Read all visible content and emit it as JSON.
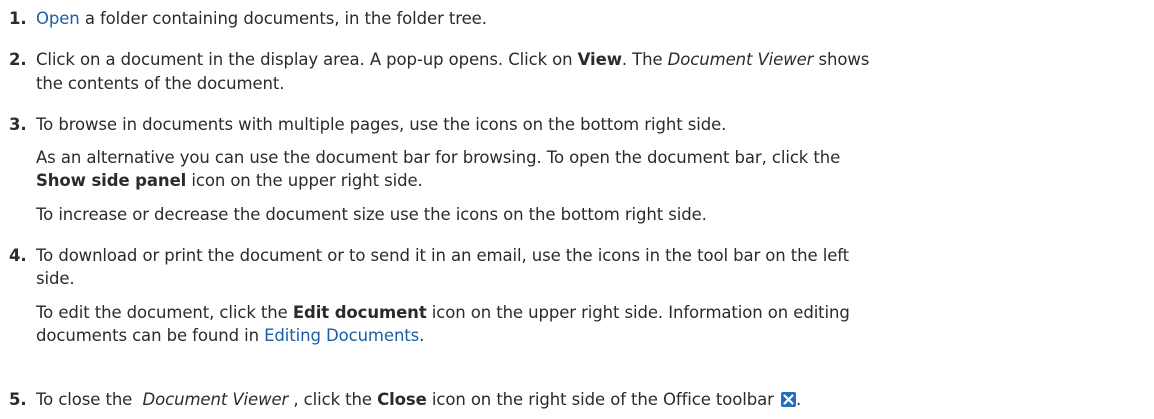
{
  "steps": [
    {
      "num": "1.",
      "lines": [
        {
          "link": "Open",
          "rest": " a folder containing documents, in the folder tree."
        }
      ]
    },
    {
      "num": "2.",
      "lines": [
        {
          "a": "Click on a document in the display area. A pop-up opens. Click on ",
          "b": "View",
          "c": ". The ",
          "i": "Document Viewer",
          "d": " shows"
        },
        {
          "a": "the contents of the document."
        }
      ]
    },
    {
      "num": "3.",
      "lines": [
        {
          "a": "To browse in documents with multiple pages, use the icons on the bottom right side."
        },
        {
          "a": "As an alternative you can use the document bar for browsing. To open the document bar, click the"
        },
        {
          "b": "Show side panel",
          "a": " icon on the upper right side."
        },
        {
          "a": "To increase or decrease the document size use the icons on the bottom right side."
        }
      ]
    },
    {
      "num": "4.",
      "lines": [
        {
          "a": "To download or print the document or to send it in an email, use the icons in the tool bar on the left"
        },
        {
          "a": "side."
        },
        {
          "a": "To edit the document, click the ",
          "b": "Edit document",
          "c": " icon on the upper right side. Information on editing"
        },
        {
          "a": "documents can be found in ",
          "link": "Editing Documents",
          "c": "."
        }
      ]
    },
    {
      "num": "5.",
      "lines": [
        {
          "a": "To close the  ",
          "i": "Document Viewer",
          "c": " , click the ",
          "b": "Close",
          "d": " icon on the right side of the Office toolbar ",
          "e": "."
        }
      ]
    }
  ],
  "icon": {
    "name": "close-icon",
    "color": "#1f6fc4"
  }
}
